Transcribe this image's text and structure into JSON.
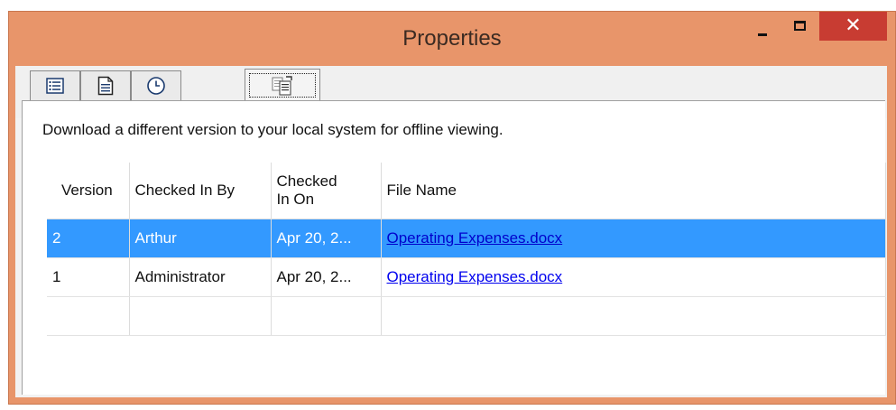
{
  "window": {
    "title": "Properties"
  },
  "controls": {
    "minimize": "–",
    "close": "✕"
  },
  "tabs": [
    {
      "icon": "list-icon",
      "active": false
    },
    {
      "icon": "document-icon",
      "active": false
    },
    {
      "icon": "clock-icon",
      "active": false
    },
    {
      "icon": "versions-icon",
      "active": true
    }
  ],
  "panel": {
    "description": "Download a different version to your local system for offline viewing."
  },
  "table": {
    "columns": [
      "Version",
      "Checked In By",
      "Checked In On",
      "File Name"
    ],
    "rows": [
      {
        "version": "2",
        "checked_in_by": "Arthur",
        "checked_in_on": "Apr 20, 2...",
        "file_name": "Operating Expenses.docx",
        "selected": true
      },
      {
        "version": "1",
        "checked_in_by": "Administrator",
        "checked_in_on": "Apr 20, 2...",
        "file_name": "Operating Expenses.docx",
        "selected": false
      }
    ]
  },
  "colors": {
    "title_bar": "#e8956a",
    "close_button": "#c83c32",
    "selection": "#3399ff",
    "link": "#0000ee"
  }
}
